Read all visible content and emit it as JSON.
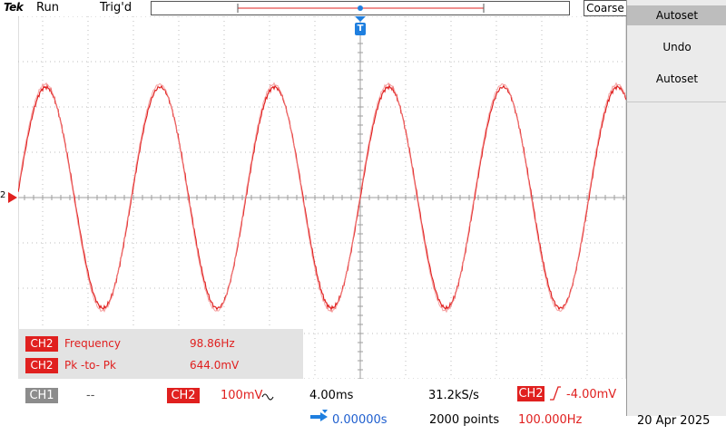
{
  "header": {
    "brand": "Tek",
    "run_state": "Run",
    "trigger_state": "Trig'd",
    "coarse_label": "Coarse"
  },
  "menu": {
    "title": "Autoset",
    "items": [
      "Undo",
      "Autoset"
    ]
  },
  "markers": {
    "ch2_ground": "2",
    "trigger_pos": "T"
  },
  "measurements": [
    {
      "channel": "CH2",
      "name": "Frequency",
      "value": "98.86Hz"
    },
    {
      "channel": "CH2",
      "name": "Pk -to- Pk",
      "value": "644.0mV"
    }
  ],
  "status": {
    "ch1_label": "CH1",
    "ch1_value": "--",
    "ch2_label": "CH2",
    "ch2_scale": "100mV",
    "ch2_coupling_icon": "ac-coupling-icon",
    "timebase": "4.00ms",
    "horiz_position": "0.00000s",
    "sample_rate": "31.2kS/s",
    "record_length": "2000 points",
    "trigger_channel": "CH2",
    "trigger_slope_icon": "rising-edge-icon",
    "trigger_level": "-4.00mV",
    "trigger_freq": "100.000Hz",
    "date": "20 Apr 2025"
  },
  "colors": {
    "trace": "#e0201f",
    "grid": "#c8c8c8",
    "menu_bg": "#ebebeb"
  }
}
